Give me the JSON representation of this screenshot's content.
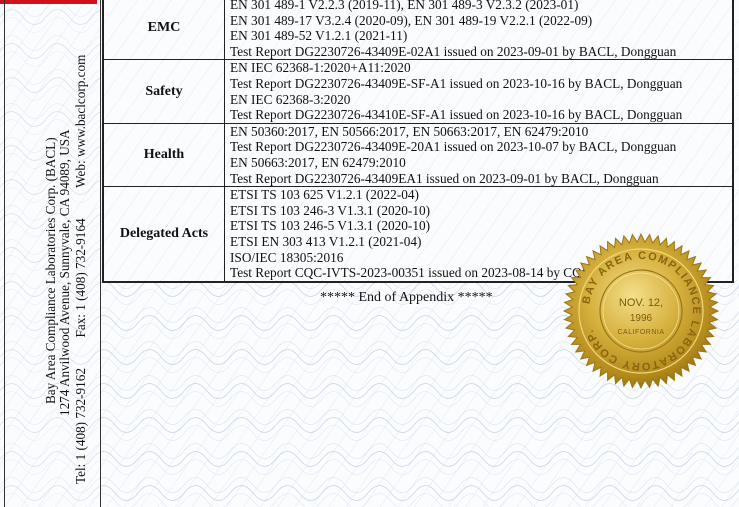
{
  "footer_left": {
    "line1": "Bay Area Compliance Laboratories Corp. (BACL)",
    "line2": "1274 Anvilwood Avenue, Sunnyvale, CA 94089, USA",
    "tel": "Tel: 1 (408) 732-9162",
    "fax": "Fax: 1 (408) 732-9164",
    "web": "Web: www.baclcorp.com"
  },
  "appendix": {
    "rows": [
      {
        "category": "EMC",
        "lines": [
          "EN 301 489-1 V2.2.3 (2019-11), EN 301 489-3 V2.3.2 (2023-01)",
          "EN 301 489-17 V3.2.4 (2020-09), EN 301 489-19 V2.2.1 (2022-09)",
          "EN 301 489-52 V1.2.1 (2021-11)",
          "Test Report DG2230726-43409E-02A1 issued on 2023-09-01 by BACL, Dongguan"
        ]
      },
      {
        "category": "Safety",
        "lines": [
          "EN IEC 62368-1:2020+A11:2020",
          "Test Report DG2230726-43409E-SF-A1 issued on 2023-10-16 by BACL, Dongguan",
          "EN IEC 62368-3:2020",
          "Test Report DG2230726-43410E-SF-A1 issued on 2023-10-16 by BACL, Dongguan"
        ]
      },
      {
        "category": "Health",
        "lines": [
          "EN 50360:2017, EN 50566:2017, EN 50663:2017, EN 62479:2010",
          "Test Report DG2230726-43409E-20A1 issued on 2023-10-07 by BACL, Dongguan",
          "EN 50663:2017, EN 62479:2010",
          "Test Report DG2230726-43409EA1 issued on 2023-09-01 by BACL, Dongguan"
        ]
      },
      {
        "category": "Delegated Acts",
        "lines": [
          "ETSI TS 103 625 V1.2.1 (2022-04)",
          "ETSI TS 103 246-3 V1.3.1 (2020-10)",
          "ETSI TS 103 246-5 V1.3.1 (2020-10)",
          "ETSI EN 303 413 V1.2.1 (2021-04)",
          "ISO/IEC 18305:2016",
          "Test Report CQC-IVTS-2023-00351 issued on 2023-08-14 by CQC, Shenzhen (China)"
        ]
      }
    ],
    "end_text": "***** End of Appendix *****"
  },
  "seal": {
    "ring_text": "BAY AREA COMPLIANCE LABORATORY CORP.",
    "date": "NOV. 12,",
    "year": "1996",
    "state": "CALIFORNIA",
    "color": "#c9a227"
  }
}
